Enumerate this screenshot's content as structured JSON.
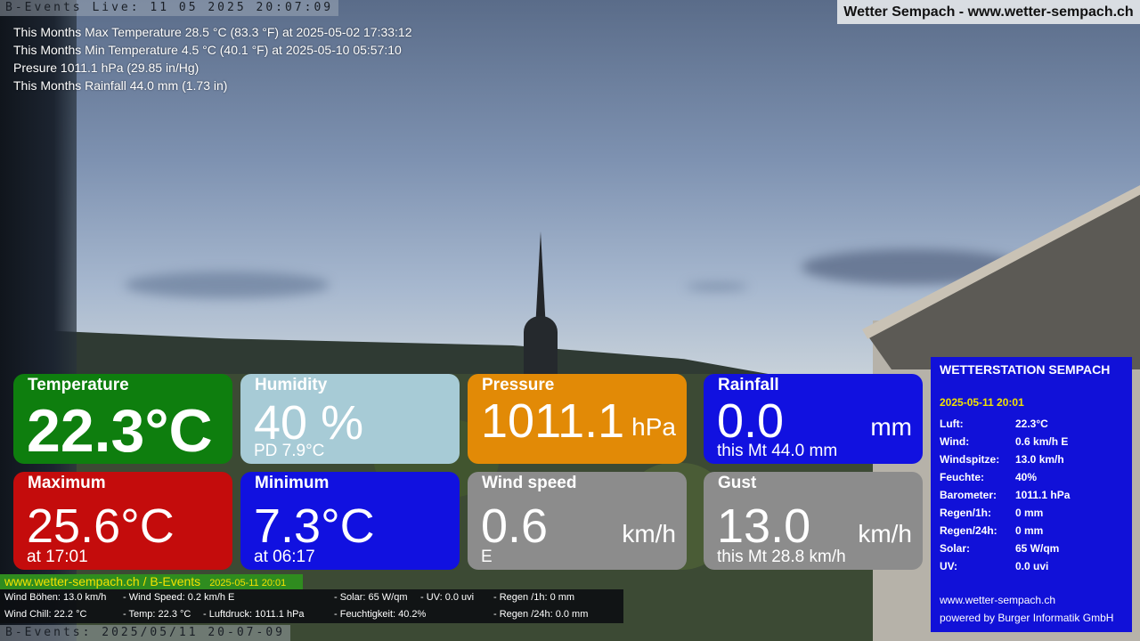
{
  "live_bar": "B-Events Live: 11 05 2025 20:07:09",
  "site_title": "Wetter Sempach - www.wetter-sempach.ch",
  "stats": [
    "This Months Max Temperature 28.5 °C (83.3 °F) at 2025-05-02 17:33:12",
    "This Months Min Temperature 4.5 °C (40.1 °F) at 2025-05-10 05:57:10",
    "Presure 1011.1 hPa (29.85 in/Hg)",
    "This Months Rainfall 44.0 mm (1.73 in)"
  ],
  "tiles": {
    "temperature": {
      "label": "Temperature",
      "value": "22.3°C",
      "color": "#0e7e0e"
    },
    "humidity": {
      "label": "Humidity",
      "value": "40 %",
      "sub": "PD 7.9°C",
      "color": "#a7cbd6"
    },
    "pressure": {
      "label": "Pressure",
      "value": "1011.1",
      "unit": "hPa",
      "color": "#e28a06"
    },
    "rainfall": {
      "label": "Rainfall",
      "value": "0.0",
      "unit": "mm",
      "sub": "this Mt 44.0 mm",
      "color": "#1111e0"
    },
    "maximum": {
      "label": "Maximum",
      "value": "25.6°C",
      "sub": "at 17:01",
      "color": "#c40c0c"
    },
    "minimum": {
      "label": "Minimum",
      "value": "7.3°C",
      "sub": "at 06:17",
      "color": "#1111e0"
    },
    "windspeed": {
      "label": "Wind speed",
      "value": "0.6",
      "unit": "km/h",
      "sub": "E",
      "color": "#8c8c8c"
    },
    "gust": {
      "label": "Gust",
      "value": "13.0",
      "unit": "km/h",
      "sub": "this Mt 28.8 km/h",
      "color": "#8c8c8c"
    }
  },
  "ticker": {
    "site": "www.wetter-sempach.ch / B-Events",
    "datetime": "2025-05-11 20:01",
    "row1": {
      "a": "Wind Böhen: 13.0 km/h",
      "b": "- Wind Speed: 0.2 km/h E",
      "c": "- Solar: 65 W/qm",
      "d": "- UV: 0.0 uvi",
      "e": "- Regen /1h:   0 mm"
    },
    "row2": {
      "a": "Wind Chill: 22.2 °C",
      "b": "- Temp: 22.3 °C",
      "c": "- Luftdruck: 1011.1 hPa",
      "d": "- Feuchtigkeit: 40.2%",
      "e": "- Regen /24h: 0.0 mm"
    }
  },
  "bottom_stamp": "B-Events: 2025/05/11 20-07-09",
  "station": {
    "title": "WETTERSTATION SEMPACH",
    "date": "2025-05-11 20:01",
    "rows": [
      {
        "k": "Luft:",
        "v": "22.3°C"
      },
      {
        "k": "Wind:",
        "v": "0.6 km/h  E"
      },
      {
        "k": "Windspitze:",
        "v": "13.0 km/h"
      },
      {
        "k": "Feuchte:",
        "v": "40%"
      },
      {
        "k": "Barometer:",
        "v": "1011.1 hPa"
      },
      {
        "k": "Regen/1h:",
        "v": "0 mm"
      },
      {
        "k": "Regen/24h:",
        "v": "0 mm"
      },
      {
        "k": "Solar:",
        "v": "65 W/qm"
      },
      {
        "k": "UV:",
        "v": "0.0 uvi"
      }
    ],
    "url": "www.wetter-sempach.ch",
    "powered": "powered by Burger Informatik GmbH",
    "color": "#1111d8"
  }
}
